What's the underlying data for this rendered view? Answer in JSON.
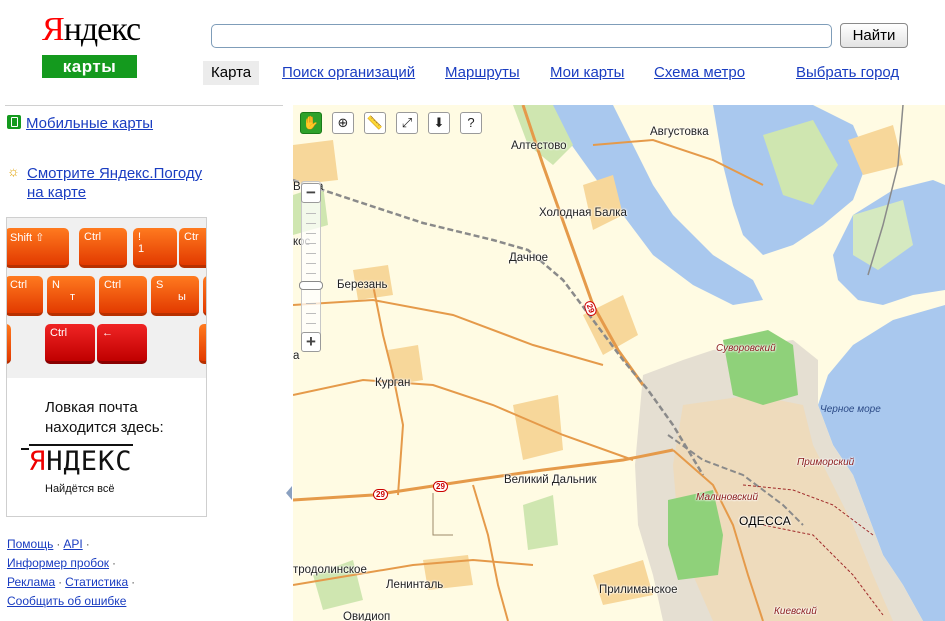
{
  "header": {
    "logo_text": "Яндекс",
    "logo_first": "Я",
    "logo_rest": "ндекс",
    "service_badge": "карты",
    "search_value": "",
    "search_button": "Найти"
  },
  "nav": {
    "items": [
      {
        "label": "Карта",
        "active": true
      },
      {
        "label": "Поиск организаций"
      },
      {
        "label": "Маршруты"
      },
      {
        "label": "Мои карты"
      },
      {
        "label": "Схема метро"
      },
      {
        "label": "Выбрать город"
      }
    ]
  },
  "sidebar": {
    "mobile_link": "Мобильные карты",
    "weather_link_line1": "Смотрите Яндекс.Погоду",
    "weather_link_line2": "на карте",
    "ad": {
      "keys": [
        "Shift ⇧",
        "Ctrl",
        "!",
        "1",
        "Ctr",
        "Ctrl",
        "N",
        "т",
        "Ctrl",
        "S",
        "ы",
        "Ctrl",
        "←"
      ],
      "text_line1": "Ловкая почта",
      "text_line2": "находится здесь:",
      "logo_first": "Я",
      "logo_rest": "НДЕКС",
      "slogan": "Найдётся всё"
    },
    "footer": {
      "help": "Помощь",
      "api": "API",
      "traffic": "Информер пробок",
      "ads": "Реклама",
      "stats": "Статистика",
      "report": "Сообщить об ошибке"
    }
  },
  "map": {
    "tools": [
      "hand-icon",
      "zoom-area-icon",
      "ruler-icon",
      "route-icon",
      "placemark-icon",
      "info-pointer-icon"
    ],
    "zoom": {
      "plus": "+",
      "minus": "−"
    },
    "labels": {
      "avgustovka": "Августовка",
      "altestovo": "Алтестово",
      "kholodnaya_balka": "Холодная Балка",
      "dachnoe": "Дачное",
      "berezan": "Березань",
      "kurgan": "Курган",
      "velikiy_dalnik": "Великий Дальник",
      "leninthal": "Ленинталь",
      "prilimanskoe": "Прилиманское",
      "trodolinskoe": "тродолинское",
      "suvorovskiy": "Суворовский",
      "chernoe_more": "Черное море",
      "primorskiy": "Приморский",
      "malinovskiy": "Малиновский",
      "odessa": "ОДЕССА",
      "kievskiy": "Киевский",
      "da_edge": "Ва да",
      "kos_edge": "кос",
      "a_edge": "а",
      "ovidiopol_edge": "Овидиоп"
    },
    "road_numbers": [
      "29",
      "29",
      "29"
    ]
  }
}
